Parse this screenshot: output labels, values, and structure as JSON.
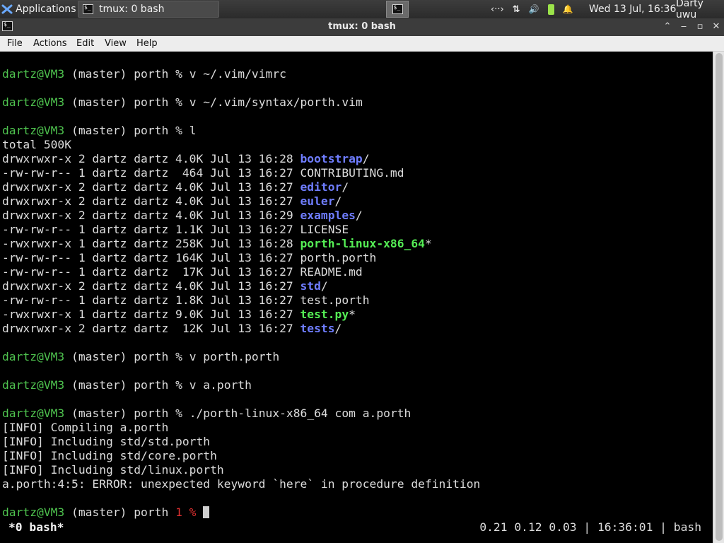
{
  "panel": {
    "applications_label": "Applications",
    "task_title": "tmux: 0 bash",
    "tray": {
      "network_symbol": "‹··›",
      "updown_symbol": "⇅",
      "volume_symbol": "🔊",
      "battery_symbol": "▯",
      "bell_symbol": "🔔"
    },
    "clock": "Wed 13 Jul, 16:36",
    "user": "Darty uwu"
  },
  "window": {
    "title": "tmux: 0 bash",
    "controls": {
      "up": "⌃",
      "minimize": "‒",
      "maximize": "▫",
      "close": "✕"
    }
  },
  "menu": [
    "File",
    "Actions",
    "Edit",
    "View",
    "Help"
  ],
  "terminal": {
    "user_host": "dartz@VM3",
    "branch": " (master) porth % ",
    "cmd1": "v ~/.vim/vimrc",
    "cmd2": "v ~/.vim/syntax/porth.vim",
    "cmd3": "l",
    "total": "total 500K",
    "listing": [
      {
        "meta": "drwxrwxr-x 2 dartz dartz 4.0K Jul 13 16:28 ",
        "name": "bootstrap",
        "suffix": "/",
        "kind": "dir"
      },
      {
        "meta": "-rw-rw-r-- 1 dartz dartz  464 Jul 13 16:27 ",
        "name": "CONTRIBUTING.md",
        "suffix": "",
        "kind": "file"
      },
      {
        "meta": "drwxrwxr-x 2 dartz dartz 4.0K Jul 13 16:27 ",
        "name": "editor",
        "suffix": "/",
        "kind": "dir"
      },
      {
        "meta": "drwxrwxr-x 2 dartz dartz 4.0K Jul 13 16:27 ",
        "name": "euler",
        "suffix": "/",
        "kind": "dir"
      },
      {
        "meta": "drwxrwxr-x 2 dartz dartz 4.0K Jul 13 16:29 ",
        "name": "examples",
        "suffix": "/",
        "kind": "dir"
      },
      {
        "meta": "-rw-rw-r-- 1 dartz dartz 1.1K Jul 13 16:27 ",
        "name": "LICENSE",
        "suffix": "",
        "kind": "file"
      },
      {
        "meta": "-rwxrwxr-x 1 dartz dartz 258K Jul 13 16:28 ",
        "name": "porth-linux-x86_64",
        "suffix": "*",
        "kind": "exe"
      },
      {
        "meta": "-rw-rw-r-- 1 dartz dartz 164K Jul 13 16:27 ",
        "name": "porth.porth",
        "suffix": "",
        "kind": "file"
      },
      {
        "meta": "-rw-rw-r-- 1 dartz dartz  17K Jul 13 16:27 ",
        "name": "README.md",
        "suffix": "",
        "kind": "file"
      },
      {
        "meta": "drwxrwxr-x 2 dartz dartz 4.0K Jul 13 16:27 ",
        "name": "std",
        "suffix": "/",
        "kind": "dir"
      },
      {
        "meta": "-rw-rw-r-- 1 dartz dartz 1.8K Jul 13 16:27 ",
        "name": "test.porth",
        "suffix": "",
        "kind": "file"
      },
      {
        "meta": "-rwxrwxr-x 1 dartz dartz 9.0K Jul 13 16:27 ",
        "name": "test.py",
        "suffix": "*",
        "kind": "exe"
      },
      {
        "meta": "drwxrwxr-x 2 dartz dartz  12K Jul 13 16:27 ",
        "name": "tests",
        "suffix": "/",
        "kind": "dir"
      }
    ],
    "cmd4": "v porth.porth",
    "cmd5": "v a.porth",
    "cmd6": "./porth-linux-x86_64 com a.porth",
    "output": [
      "[INFO] Compiling a.porth",
      "[INFO] Including std/std.porth",
      "[INFO] Including std/core.porth",
      "[INFO] Including std/linux.porth",
      "a.porth:4:5: ERROR: unexpected keyword `here` in procedure definition"
    ],
    "final_prompt_prefix": " (master) porth ",
    "exit_status": "1 %",
    "status_left": "*0 bash*",
    "status_right": "0.21 0.12 0.03 | 16:36:01 | bash"
  }
}
